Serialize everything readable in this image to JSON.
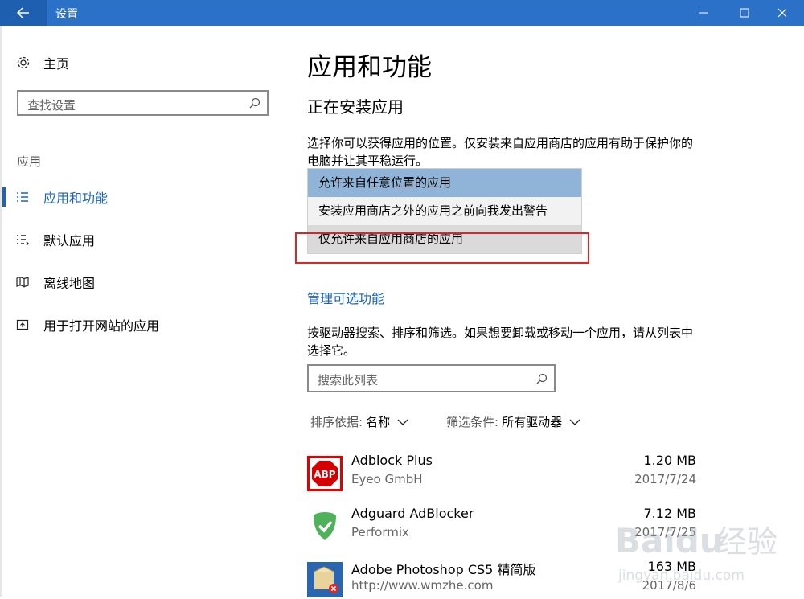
{
  "titlebar": {
    "back_icon": "arrow-left-icon",
    "title": "设置",
    "accent": "#2b71c8"
  },
  "sidebar": {
    "home_label": "主页",
    "search_placeholder": "查找设置",
    "section_label": "应用",
    "items": [
      {
        "icon": "apps-features-icon",
        "label": "应用和功能",
        "active": true
      },
      {
        "icon": "default-apps-icon",
        "label": "默认应用",
        "active": false
      },
      {
        "icon": "offline-maps-icon",
        "label": "离线地图",
        "active": false
      },
      {
        "icon": "apps-for-websites-icon",
        "label": "用于打开网站的应用",
        "active": false
      }
    ]
  },
  "main": {
    "title": "应用和功能",
    "installing_heading": "正在安装应用",
    "installing_desc": "选择你可以获得应用的位置。仅安装来自应用商店的应用有助于保护你的电脑并让其平稳运行。",
    "install_options": [
      "允许来自任意位置的应用",
      "安装应用商店之外的应用之前向我发出警告",
      "仅允许来自应用商店的应用"
    ],
    "manage_link": "管理可选功能",
    "list_desc": "按驱动器搜索、排序和筛选。如果想要卸载或移动一个应用，请从列表中选择它。",
    "list_search_placeholder": "搜索此列表",
    "sort_label": "排序依据:",
    "sort_value": "名称",
    "filter_label": "筛选条件:",
    "filter_value": "所有驱动器",
    "apps": [
      {
        "name": "Adblock Plus",
        "publisher": "Eyeo GmbH",
        "size": "1.20 MB",
        "date": "2017/7/24",
        "icon": "abp-icon"
      },
      {
        "name": "Adguard AdBlocker",
        "publisher": "Performix",
        "size": "7.12 MB",
        "date": "2017/7/25",
        "icon": "adguard-shield-icon"
      },
      {
        "name": "Adobe Photoshop CS5 精简版",
        "publisher": "http://www.wmzhe.com",
        "size": "163 MB",
        "date": "2017/8/6",
        "icon": "photoshop-installer-icon"
      }
    ]
  },
  "watermark": {
    "text1": "Baidu",
    "text2": "经验",
    "text3": "jingyan.baidu.com"
  }
}
